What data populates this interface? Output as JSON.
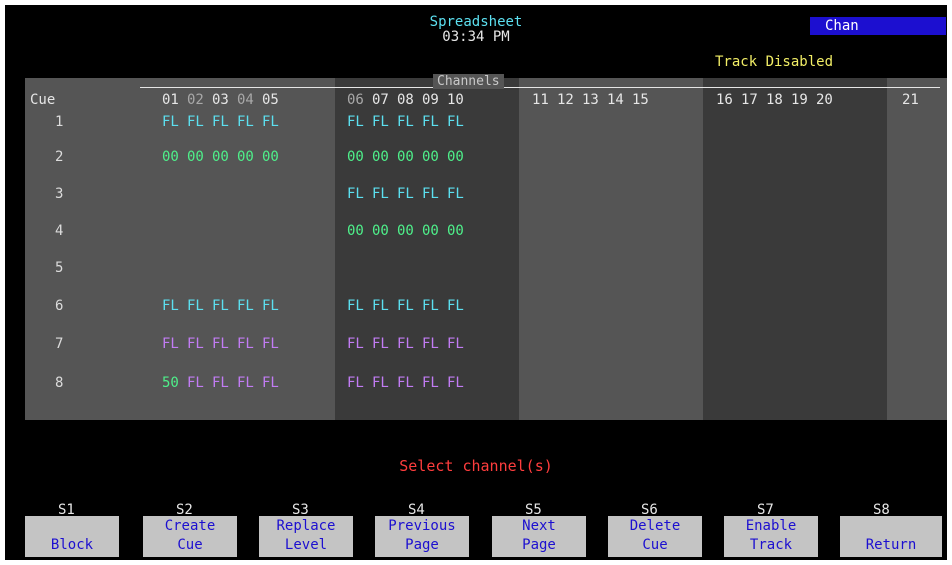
{
  "header": {
    "title": "Spreadsheet",
    "clock": "03:34 PM",
    "mode": "Chan",
    "track_status": "Track Disabled"
  },
  "spreadsheet": {
    "group_label": "Channels",
    "cue_column_header": "Cue",
    "channel_headers": [
      "01",
      "02",
      "03",
      "04",
      "05",
      "06",
      "07",
      "08",
      "09",
      "10",
      "11",
      "12",
      "13",
      "14",
      "15",
      "16",
      "17",
      "18",
      "19",
      "20",
      "21"
    ],
    "cues": [
      {
        "cue": "1",
        "levels": [
          "FL",
          "FL",
          "FL",
          "FL",
          "FL",
          "FL",
          "FL",
          "FL",
          "FL",
          "FL"
        ],
        "colors": [
          "cyan",
          "cyan",
          "cyan",
          "cyan",
          "cyan",
          "cyan",
          "cyan",
          "cyan",
          "cyan",
          "cyan"
        ]
      },
      {
        "cue": "2",
        "levels": [
          "00",
          "00",
          "00",
          "00",
          "00",
          "00",
          "00",
          "00",
          "00",
          "00"
        ],
        "colors": [
          "green",
          "green",
          "green",
          "green",
          "green",
          "green",
          "green",
          "green",
          "green",
          "green"
        ]
      },
      {
        "cue": "3",
        "levels": [
          "",
          "",
          "",
          "",
          "",
          "FL",
          "FL",
          "FL",
          "FL",
          "FL"
        ],
        "colors": [
          "",
          "",
          "",
          "",
          "",
          "cyan",
          "cyan",
          "cyan",
          "cyan",
          "cyan"
        ]
      },
      {
        "cue": "4",
        "levels": [
          "",
          "",
          "",
          "",
          "",
          "00",
          "00",
          "00",
          "00",
          "00"
        ],
        "colors": [
          "",
          "",
          "",
          "",
          "",
          "green",
          "green",
          "green",
          "green",
          "green"
        ]
      },
      {
        "cue": "5",
        "levels": [
          "",
          "",
          "",
          "",
          "",
          "",
          "",
          "",
          "",
          ""
        ],
        "colors": [
          "",
          "",
          "",
          "",
          "",
          "",
          "",
          "",
          "",
          ""
        ]
      },
      {
        "cue": "6",
        "levels": [
          "FL",
          "FL",
          "FL",
          "FL",
          "FL",
          "FL",
          "FL",
          "FL",
          "FL",
          "FL"
        ],
        "colors": [
          "cyan",
          "cyan",
          "cyan",
          "cyan",
          "cyan",
          "cyan",
          "cyan",
          "cyan",
          "cyan",
          "cyan"
        ]
      },
      {
        "cue": "7",
        "levels": [
          "FL",
          "FL",
          "FL",
          "FL",
          "FL",
          "FL",
          "FL",
          "FL",
          "FL",
          "FL"
        ],
        "colors": [
          "purple",
          "purple",
          "purple",
          "purple",
          "purple",
          "purple",
          "purple",
          "purple",
          "purple",
          "purple"
        ]
      },
      {
        "cue": "8",
        "levels": [
          "50",
          "FL",
          "FL",
          "FL",
          "FL",
          "FL",
          "FL",
          "FL",
          "FL",
          "FL"
        ],
        "colors": [
          "green",
          "purple",
          "purple",
          "purple",
          "purple",
          "purple",
          "purple",
          "purple",
          "purple",
          "purple"
        ]
      }
    ]
  },
  "prompt": "Select channel(s)",
  "softkeys": [
    {
      "key": "S1",
      "line1": "",
      "line2": "Block"
    },
    {
      "key": "S2",
      "line1": "Create",
      "line2": "Cue"
    },
    {
      "key": "S3",
      "line1": "Replace",
      "line2": "Level"
    },
    {
      "key": "S4",
      "line1": "Previous",
      "line2": "Page"
    },
    {
      "key": "S5",
      "line1": "Next",
      "line2": "Page"
    },
    {
      "key": "S6",
      "line1": "Delete",
      "line2": "Cue"
    },
    {
      "key": "S7",
      "line1": "Enable",
      "line2": "Track"
    },
    {
      "key": "S8",
      "line1": "",
      "line2": "Return"
    }
  ],
  "colors": {
    "level_full": "#5ce0f0",
    "level_zero": "#4ef08a",
    "level_tracked": "#c27cf4",
    "prompt": "#ff3d3d",
    "mode_badge": "#1c0fd0"
  }
}
